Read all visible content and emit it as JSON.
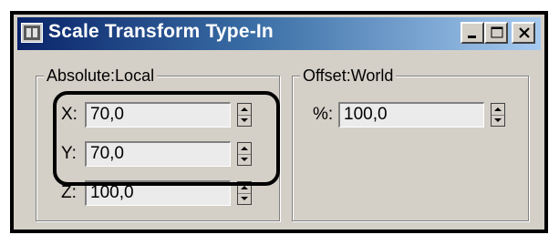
{
  "window": {
    "title": "Scale Transform Type-In",
    "icon": "app-icon",
    "buttons": [
      "minimize",
      "maximize",
      "close"
    ]
  },
  "absolute": {
    "label": "Absolute:Local",
    "fields": [
      {
        "axis": "X:",
        "value": "70,0"
      },
      {
        "axis": "Y:",
        "value": "70,0"
      },
      {
        "axis": "Z:",
        "value": "100,0"
      }
    ]
  },
  "offset": {
    "label": "Offset:World",
    "field": {
      "axis": "%:",
      "value": "100,0"
    }
  },
  "colors": {
    "title_gradient_start": "#0a246a",
    "title_gradient_end": "#a6caf0",
    "face": "#d4d0c8",
    "field_bg": "#ebebeb"
  }
}
